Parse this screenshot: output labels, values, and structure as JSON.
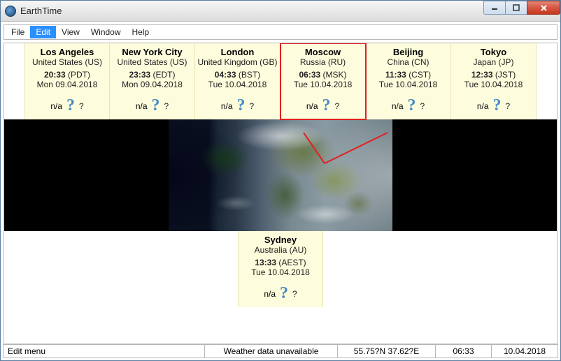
{
  "window": {
    "title": "EarthTime"
  },
  "menu": {
    "items": [
      "File",
      "Edit",
      "View",
      "Window",
      "Help"
    ],
    "selected_index": 1
  },
  "clocks_top": [
    {
      "city": "Los Angeles",
      "country": "United States (US)",
      "time": "20:33",
      "tz": "(PDT)",
      "date": "Mon 09.04.2018",
      "weather_na": "n/a",
      "highlight": false
    },
    {
      "city": "New York City",
      "country": "United States (US)",
      "time": "23:33",
      "tz": "(EDT)",
      "date": "Mon 09.04.2018",
      "weather_na": "n/a",
      "highlight": false
    },
    {
      "city": "London",
      "country": "United Kingdom (GB)",
      "time": "04:33",
      "tz": "(BST)",
      "date": "Tue 10.04.2018",
      "weather_na": "n/a",
      "highlight": false
    },
    {
      "city": "Moscow",
      "country": "Russia (RU)",
      "time": "06:33",
      "tz": "(MSK)",
      "date": "Tue 10.04.2018",
      "weather_na": "n/a",
      "highlight": true
    },
    {
      "city": "Beijing",
      "country": "China (CN)",
      "time": "11:33",
      "tz": "(CST)",
      "date": "Tue 10.04.2018",
      "weather_na": "n/a",
      "highlight": false
    },
    {
      "city": "Tokyo",
      "country": "Japan (JP)",
      "time": "12:33",
      "tz": "(JST)",
      "date": "Tue 10.04.2018",
      "weather_na": "n/a",
      "highlight": false
    }
  ],
  "clocks_bottom": [
    {
      "city": "Sydney",
      "country": "Australia (AU)",
      "time": "13:33",
      "tz": "(AEST)",
      "date": "Tue 10.04.2018",
      "weather_na": "n/a",
      "highlight": false
    }
  ],
  "statusbar": {
    "hint": "Edit menu",
    "weather": "Weather data unavailable",
    "coords": "55.75?N  37.62?E",
    "time": "06:33",
    "date": "10.04.2018"
  }
}
